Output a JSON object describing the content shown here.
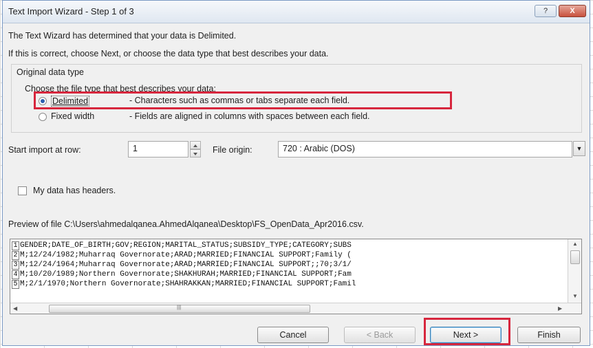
{
  "dialog": {
    "title": "Text Import Wizard - Step 1 of 3",
    "help_label": "?",
    "close_label": "X",
    "intro_line1": "The Text Wizard has determined that your data is Delimited.",
    "intro_line2": "If this is correct, choose Next, or choose the data type that best describes your data."
  },
  "original_type": {
    "group_label": "Original data type",
    "prompt": "Choose the file type that best describes your data:",
    "options": [
      {
        "label": "Delimited",
        "description": "- Characters such as commas or tabs separate each field.",
        "selected": true
      },
      {
        "label": "Fixed width",
        "description": "- Fields are aligned in columns with spaces between each field.",
        "selected": false
      }
    ]
  },
  "start_row": {
    "label": "Start import at row:",
    "value": "1"
  },
  "file_origin": {
    "label": "File origin:",
    "value": "720 : Arabic (DOS)"
  },
  "headers_checkbox": {
    "label": "My data has headers.",
    "checked": false
  },
  "preview": {
    "label": "Preview of file C:\\Users\\ahmedalqanea.AhmedAlqanea\\Desktop\\FS_OpenData_Apr2016.csv.",
    "rows": [
      {
        "num": "1",
        "text": "GENDER;DATE_OF_BIRTH;GOV;REGION;MARITAL_STATUS;SUBSIDY_TYPE;CATEGORY;SUBS"
      },
      {
        "num": "2",
        "text": "M;12/24/1982;Muharraq Governorate;ARAD;MARRIED;FINANCIAL SUPPORT;Family ("
      },
      {
        "num": "3",
        "text": "M;12/24/1964;Muharraq Governorate;ARAD;MARRIED;FINANCIAL SUPPORT;;70;3/1/"
      },
      {
        "num": "4",
        "text": "M;10/20/1989;Northern Governorate;SHAKHURAH;MARRIED;FINANCIAL SUPPORT;Fam"
      },
      {
        "num": "5",
        "text": "M;2/1/1970;Northern Governorate;SHAHRAKKAN;MARRIED;FINANCIAL SUPPORT;Famil"
      }
    ]
  },
  "buttons": {
    "cancel": "Cancel",
    "back": "< Back",
    "next": "Next >",
    "finish": "Finish"
  },
  "colors": {
    "highlight": "#d7263d"
  }
}
